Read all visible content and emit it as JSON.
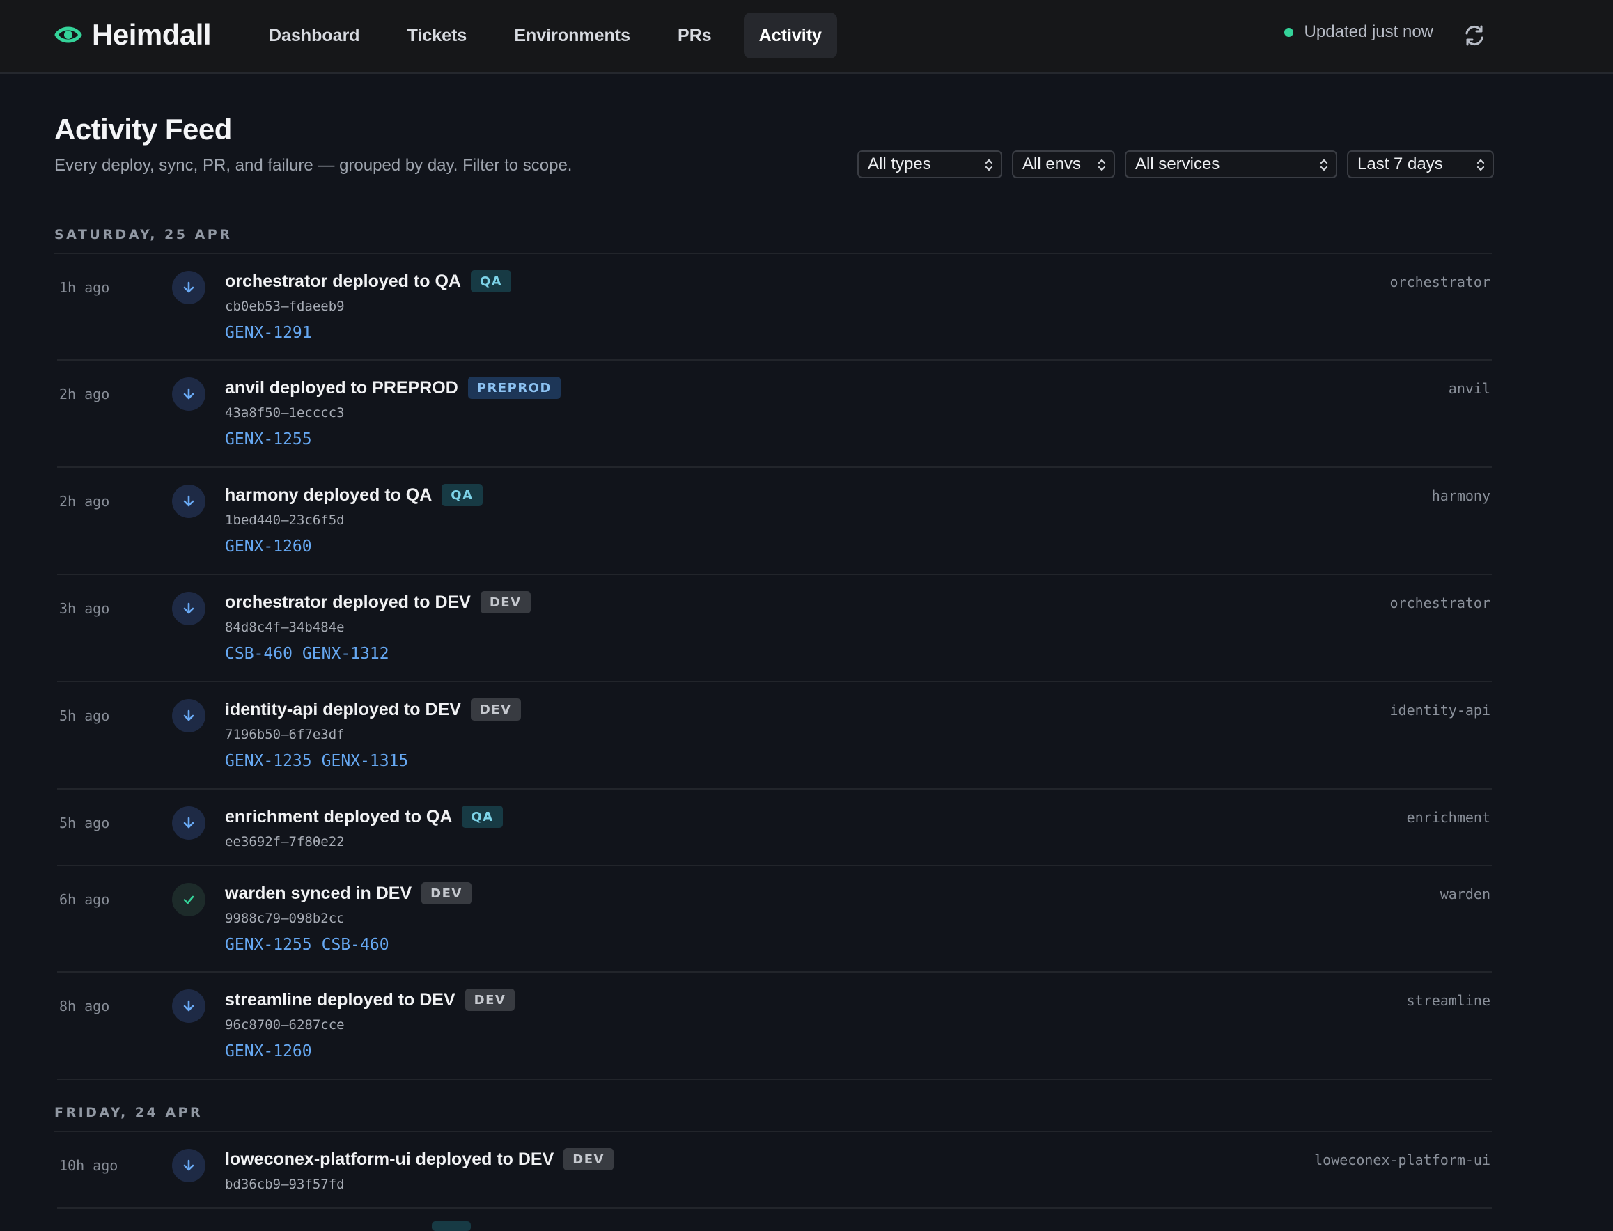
{
  "header": {
    "brand": "Heimdall",
    "nav": [
      "Dashboard",
      "Tickets",
      "Environments",
      "PRs",
      "Activity"
    ],
    "active_tab": "Activity",
    "status": "Updated just now",
    "accent": "#34d399"
  },
  "page": {
    "title": "Activity Feed",
    "subtitle": "Every deploy, sync, PR, and failure — grouped by day. Filter to scope."
  },
  "filters": {
    "types": "All types",
    "envs": "All envs",
    "services": "All services",
    "range": "Last 7 days"
  },
  "days": [
    {
      "label": "SATURDAY, 25 APR",
      "events": [
        {
          "time": "1h ago",
          "kind": "deploy",
          "icon": "arrow-down-icon",
          "title": "orchestrator deployed to QA",
          "env": "QA",
          "hash": "cb0eb53—fdaeeb9",
          "tickets": [
            "GENX-1291"
          ],
          "service": "orchestrator"
        },
        {
          "time": "2h ago",
          "kind": "deploy",
          "icon": "arrow-down-icon",
          "title": "anvil deployed to PREPROD",
          "env": "PREPROD",
          "hash": "43a8f50—1ecccc3",
          "tickets": [
            "GENX-1255"
          ],
          "service": "anvil"
        },
        {
          "time": "2h ago",
          "kind": "deploy",
          "icon": "arrow-down-icon",
          "title": "harmony deployed to QA",
          "env": "QA",
          "hash": "1bed440—23c6f5d",
          "tickets": [
            "GENX-1260"
          ],
          "service": "harmony"
        },
        {
          "time": "3h ago",
          "kind": "deploy",
          "icon": "arrow-down-icon",
          "title": "orchestrator deployed to DEV",
          "env": "DEV",
          "hash": "84d8c4f—34b484e",
          "tickets": [
            "CSB-460",
            "GENX-1312"
          ],
          "service": "orchestrator"
        },
        {
          "time": "5h ago",
          "kind": "deploy",
          "icon": "arrow-down-icon",
          "title": "identity-api deployed to DEV",
          "env": "DEV",
          "hash": "7196b50—6f7e3df",
          "tickets": [
            "GENX-1235",
            "GENX-1315"
          ],
          "service": "identity-api"
        },
        {
          "time": "5h ago",
          "kind": "deploy",
          "icon": "arrow-down-icon",
          "title": "enrichment deployed to QA",
          "env": "QA",
          "hash": "ee3692f—7f80e22",
          "tickets": [],
          "service": "enrichment"
        },
        {
          "time": "6h ago",
          "kind": "sync",
          "icon": "check-icon",
          "title": "warden synced in DEV",
          "env": "DEV",
          "hash": "9988c79—098b2cc",
          "tickets": [
            "GENX-1255",
            "CSB-460"
          ],
          "service": "warden"
        },
        {
          "time": "8h ago",
          "kind": "deploy",
          "icon": "arrow-down-icon",
          "title": "streamline deployed to DEV",
          "env": "DEV",
          "hash": "96c8700—6287cce",
          "tickets": [
            "GENX-1260"
          ],
          "service": "streamline"
        }
      ]
    },
    {
      "label": "FRIDAY, 24 APR",
      "events": [
        {
          "time": "10h ago",
          "kind": "deploy",
          "icon": "arrow-down-icon",
          "title": "loweconex-platform-ui deployed to DEV",
          "env": "DEV",
          "hash": "bd36cb9—93f57fd",
          "tickets": [],
          "service": "loweconex-platform-ui"
        }
      ]
    }
  ]
}
